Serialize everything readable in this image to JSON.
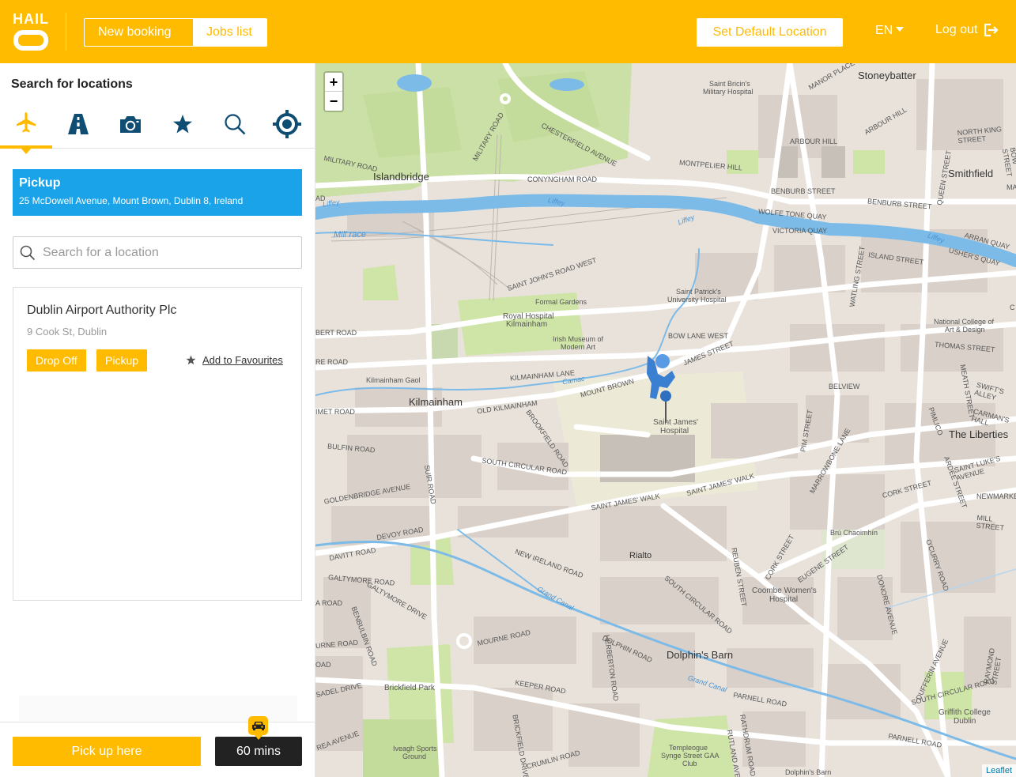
{
  "header": {
    "logo_text": "HAIL",
    "nav": {
      "new_booking": "New booking",
      "jobs_list": "Jobs list"
    },
    "set_default_location": "Set Default Location",
    "language": "EN",
    "logout": "Log out",
    "brand_color": "#ffbb00"
  },
  "sidebar": {
    "search_title": "Search for locations",
    "category_tabs": [
      {
        "icon": "airplane-icon",
        "active": true
      },
      {
        "icon": "road-icon",
        "active": false
      },
      {
        "icon": "camera-icon",
        "active": false
      },
      {
        "icon": "star-icon",
        "active": false
      },
      {
        "icon": "search-icon",
        "active": false
      },
      {
        "icon": "crosshair-icon",
        "active": false
      }
    ],
    "pickup": {
      "title": "Pickup",
      "address": "25 McDowell Avenue, Mount Brown, Dublin 8, Ireland",
      "color": "#1aa3e8"
    },
    "search": {
      "placeholder": "Search for a location"
    },
    "results": [
      {
        "name": "Dublin Airport Authority Plc",
        "address": "9 Cook St, Dublin",
        "drop_off_label": "Drop Off",
        "pickup_label": "Pickup",
        "favourite_label": "Add to Favourites"
      }
    ],
    "pick_up_here": "Pick up here",
    "eta": "60 mins"
  },
  "map": {
    "zoom_in": "+",
    "zoom_out": "−",
    "attribution": "Leaflet",
    "labels": {
      "stoneybatter": "Stoneybatter",
      "smithfield": "Smithfield",
      "islandbridge": "Islandbridge",
      "kilmainham": "Kilmainham",
      "kilmainham_gaol": "Kilmainham Gaol",
      "the_liberties": "The Liberties",
      "rialto": "Rialto",
      "dolphins_barn": "Dolphin's Barn",
      "dolphins_barn_small": "Dolphin's Barn",
      "st_brics": "Saint Bricin's",
      "st_brics2": "Military Hospital",
      "st_patricks": "Saint Patrick's",
      "st_patricks2": "University Hospital",
      "formal_gardens": "Formal Gardens",
      "royal_hospital": "Royal Hospital",
      "royal_hospital2": "Kilmainham",
      "imma": "Irish Museum of",
      "imma2": "Modern Art",
      "st_james": "Saint James'",
      "st_james2": "Hospital",
      "ncad": "National College of",
      "ncad2": "Art & Design",
      "bru": "Brú Chaoimhín",
      "coombe": "Coombe Women's",
      "coombe2": "Hospital",
      "griffith": "Griffith College",
      "griffith2": "Dublin",
      "brickfield_park": "Brickfield Park",
      "iveagh": "Iveagh Sports",
      "iveagh2": "Ground",
      "templeogue": "Templeogue",
      "templeogue2": "Synge Street GAA",
      "templeogue3": "Club",
      "liffey1": "Liffey",
      "liffey2": "Liffey",
      "liffey3": "Liffey",
      "liffey4": "Liffey",
      "mill_race": "Mill race",
      "camac": "Camac",
      "grand_canal1": "Grand Canal",
      "grand_canal2": "Grand Canal",
      "manor_place": "MANOR PLACE",
      "arbour_hill": "ARBOUR HILL",
      "arbour_hill2": "ARBOUR HILL",
      "north_king": "NORTH KING STREET",
      "bow_street": "BOW STREET",
      "may": "MAY",
      "queen_street": "QUEEN STREET",
      "military_road": "MILITARY ROAD",
      "military_road2": "MILITARY ROAD",
      "chesterfield": "CHESTERFIELD AVENUE",
      "montpelier": "MONTPELIER HILL",
      "benburb": "BENBURB STREET",
      "benburb2": "BENBURB STREET",
      "conyngham": "CONYNGHAM ROAD",
      "wolfe_tone": "WOLFE TONE QUAY",
      "victoria_quay": "VICTORIA QUAY",
      "arran_quay": "ARRAN QUAY",
      "ushers_quay": "USHER'S QUAY",
      "island_street": "ISLAND STREET",
      "watling": "WATLING STREET",
      "st_johns": "SAINT JOHN'S ROAD WEST",
      "bow_lane": "BOW LANE WEST",
      "james_street": "JAMES STREET",
      "thomas_street": "THOMAS STREET",
      "meath_street": "MEATH STREET",
      "swifts": "SWIFT'S ALLEY",
      "carmans": "CARMAN'S HALL",
      "bert_road": "BERT ROAD",
      "re_road": "RE ROAD",
      "kilmainham_lane": "KILMAINHAM LANE",
      "mount_brown": "MOUNT BROWN",
      "old_kilmainham": "OLD KILMAINHAM",
      "imet_road": "IMET ROAD",
      "belview": "BELVIEW",
      "pimlico": "PIMLICO",
      "pim_street": "PIM STREET",
      "marrowbone": "MARROWBONE LANE",
      "brookfield": "BROOKFIELD ROAD",
      "bulfin": "BULFIN ROAD",
      "south_circular": "SOUTH CIRCULAR ROAD",
      "suirs_road": "SUIR ROAD",
      "st_james_walk": "SAINT JAMES' WALK",
      "st_james_walk2": "SAINT JAMES' WALK",
      "cork_street": "CORK STREET",
      "ardee": "ARDEE STREET",
      "st_lukes": "SAINT LUKE'S AVENUE",
      "newmarket": "NEWMARKET",
      "mill_street": "MILL STREET",
      "goldenbridge": "GOLDENBRIDGE AVENUE",
      "devoy": "DEVOY ROAD",
      "davitt": "DAVITT ROAD",
      "galtymore_road": "GALTYMORE ROAD",
      "galtymore_drive": "GALTYMORE DRIVE",
      "a_road": "A ROAD",
      "new_ireland": "NEW IRELAND ROAD",
      "reuben": "REUBEN STREET",
      "south_circular2": "SOUTH CIRCULAR ROAD",
      "cork_street2": "CORK STREET",
      "eugene": "EUGENE STREET",
      "ocurry": "O'CURRY ROAD",
      "donore": "DONORE AVENUE",
      "urne_road": "URNE ROAD",
      "benbulbin": "BENBULBIN ROAD",
      "mourne": "MOURNE ROAD",
      "herberton": "HERBERTON ROAD",
      "dolphin_road": "DOLPHIN ROAD",
      "dufferin": "DUFFERIN AVENUE",
      "raymond": "RAYMOND STREET",
      "sadel": "SADEL DRIVE",
      "keeper": "KEEPER ROAD",
      "parnell": "PARNELL ROAD",
      "parnell2": "PARNELL ROAD",
      "south_circular3": "SOUTH CIRCULAR ROAD",
      "rea_avenue": "REA AVENUE",
      "brickfield_drive": "BRICKFIELD DRIVE",
      "crumlin": "CRUMLIN ROAD",
      "rutland": "RUTLAND AVENUE",
      "rathdrum": "RATHDRUM ROAD",
      "oad": "OAD",
      "ad": "AD",
      "c": "C"
    }
  }
}
